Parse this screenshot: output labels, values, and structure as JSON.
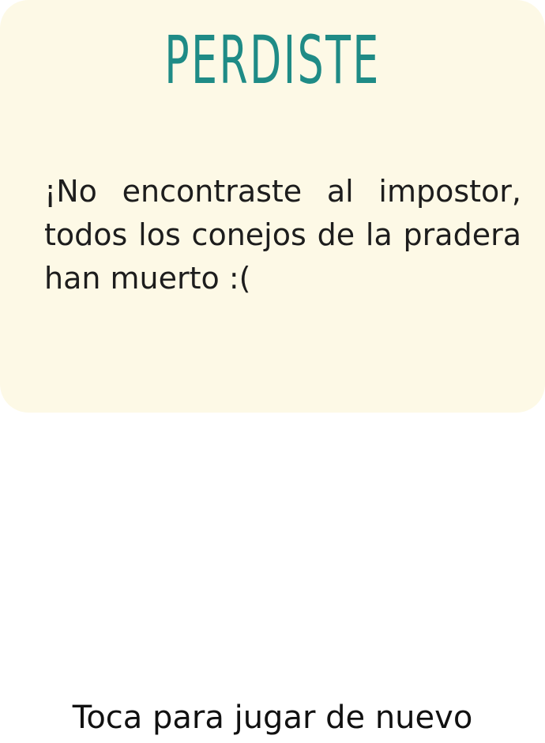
{
  "card": {
    "title": "PERDISTE",
    "message": "¡No encontraste al impostor, todos los conejos de la pradera han muerto :("
  },
  "footer": {
    "cta_label": "Toca para jugar de nuevo"
  },
  "colors": {
    "card_background": "#fdf9e6",
    "title": "#1f8b86",
    "text": "#1d1d1d"
  }
}
